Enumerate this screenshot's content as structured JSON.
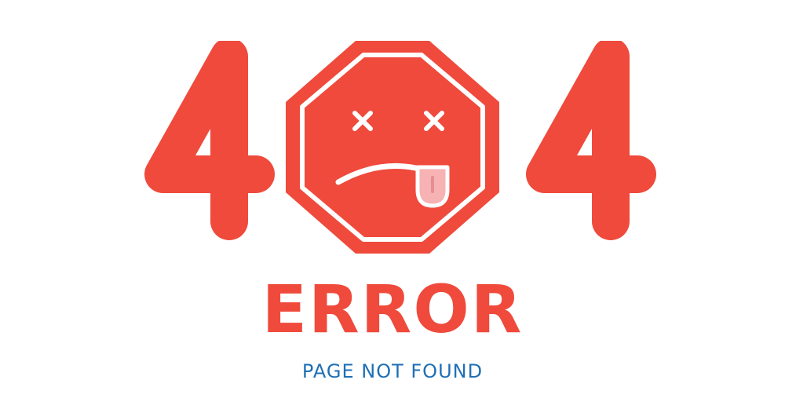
{
  "code": {
    "first_digit": "4",
    "second_digit": "0",
    "third_digit": "4"
  },
  "title": "ERROR",
  "subtitle": "PAGE NOT FOUND",
  "colors": {
    "accent_red": "#ef4a3c",
    "tongue_pink": "#f7b2b4",
    "tongue_line": "#e58d93",
    "subtitle_blue": "#1f6fb5",
    "background": "#ffffff"
  },
  "icons": {
    "stop_sign": "stop-sign-face-icon",
    "eyes": "x-eye-icon",
    "mouth": "frown-mouth-icon",
    "tongue": "tongue-icon"
  }
}
